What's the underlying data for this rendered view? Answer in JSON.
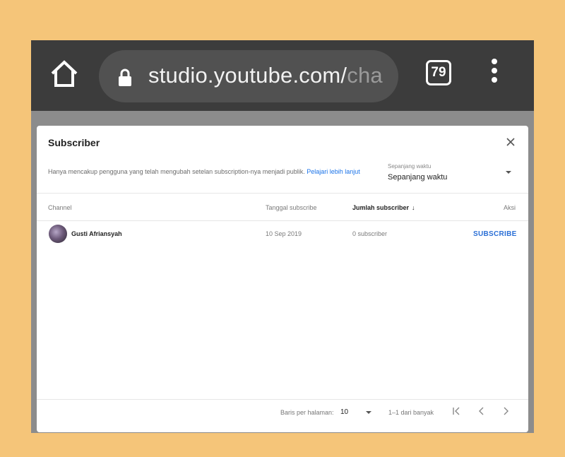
{
  "browser": {
    "url_main": "studio.youtube.com/",
    "url_faded": "cha",
    "tab_count": "79"
  },
  "dialog": {
    "title": "Subscriber",
    "info_text": "Hanya mencakup pengguna yang telah mengubah setelan subscription-nya menjadi publik.",
    "learn_more": "Pelajari lebih lanjut",
    "period_label": "Sepanjang waktu",
    "period_value": "Sepanjang waktu"
  },
  "table": {
    "headers": {
      "channel": "Channel",
      "date": "Tanggal subscribe",
      "count": "Jumlah subscriber",
      "action": "Aksi"
    },
    "rows": [
      {
        "channel": "Gusti Afriansyah",
        "date": "10 Sep 2019",
        "subscribers": "0 subscriber",
        "action": "SUBSCRIBE"
      }
    ]
  },
  "footer": {
    "rows_label": "Baris per halaman:",
    "rows_value": "10",
    "range": "1–1 dari banyak"
  }
}
